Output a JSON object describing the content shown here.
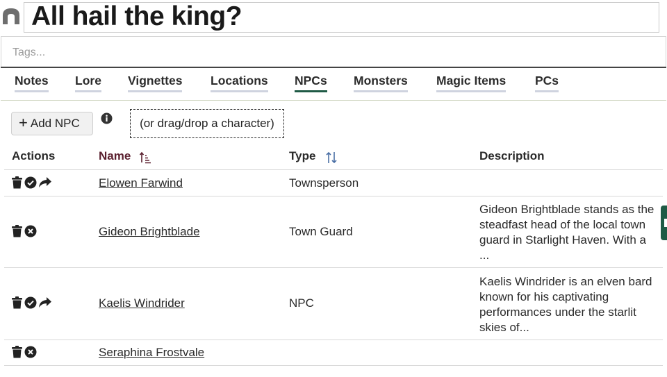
{
  "page": {
    "title": "All hail the king?",
    "home_icon": "home-icon"
  },
  "tags": {
    "placeholder": "Tags..."
  },
  "tabs": [
    {
      "label": "Notes",
      "active": false
    },
    {
      "label": "Lore",
      "active": false
    },
    {
      "label": "Vignettes",
      "active": false
    },
    {
      "label": "Locations",
      "active": false
    },
    {
      "label": "NPCs",
      "active": true
    },
    {
      "label": "Monsters",
      "active": false
    },
    {
      "label": "Magic Items",
      "active": false
    },
    {
      "label": "PCs",
      "active": false
    }
  ],
  "toolbar": {
    "add_label": "Add NPC",
    "info_icon": "info-icon",
    "drop_hint": "(or drag/drop a character)"
  },
  "table": {
    "headers": {
      "actions": "Actions",
      "name": "Name",
      "type": "Type",
      "description": "Description"
    },
    "sort": {
      "column": "name",
      "direction": "ascending"
    },
    "rows": [
      {
        "name": "Elowen Farwind",
        "type": "Townsperson",
        "description": "",
        "icons": [
          "trash-icon",
          "check-circle-icon",
          "share-icon"
        ]
      },
      {
        "name": "Gideon Brightblade",
        "type": "Town Guard",
        "description": "Gideon Brightblade stands as the steadfast head of the local town guard in Starlight Haven. With a ...",
        "icons": [
          "trash-icon",
          "x-circle-icon"
        ]
      },
      {
        "name": "Kaelis Windrider",
        "type": "NPC",
        "description": "Kaelis Windrider is an elven bard known for his captivating performances under the starlit skies of...",
        "icons": [
          "trash-icon",
          "check-circle-icon",
          "share-icon"
        ]
      },
      {
        "name": "Seraphina Frostvale",
        "type": "",
        "description": "",
        "icons": [
          "trash-icon",
          "x-circle-icon"
        ]
      }
    ]
  },
  "colors": {
    "accent": "#1f5a45",
    "sorted_header": "#5a1f2e",
    "active_tab_glow": "#f7bea0"
  }
}
